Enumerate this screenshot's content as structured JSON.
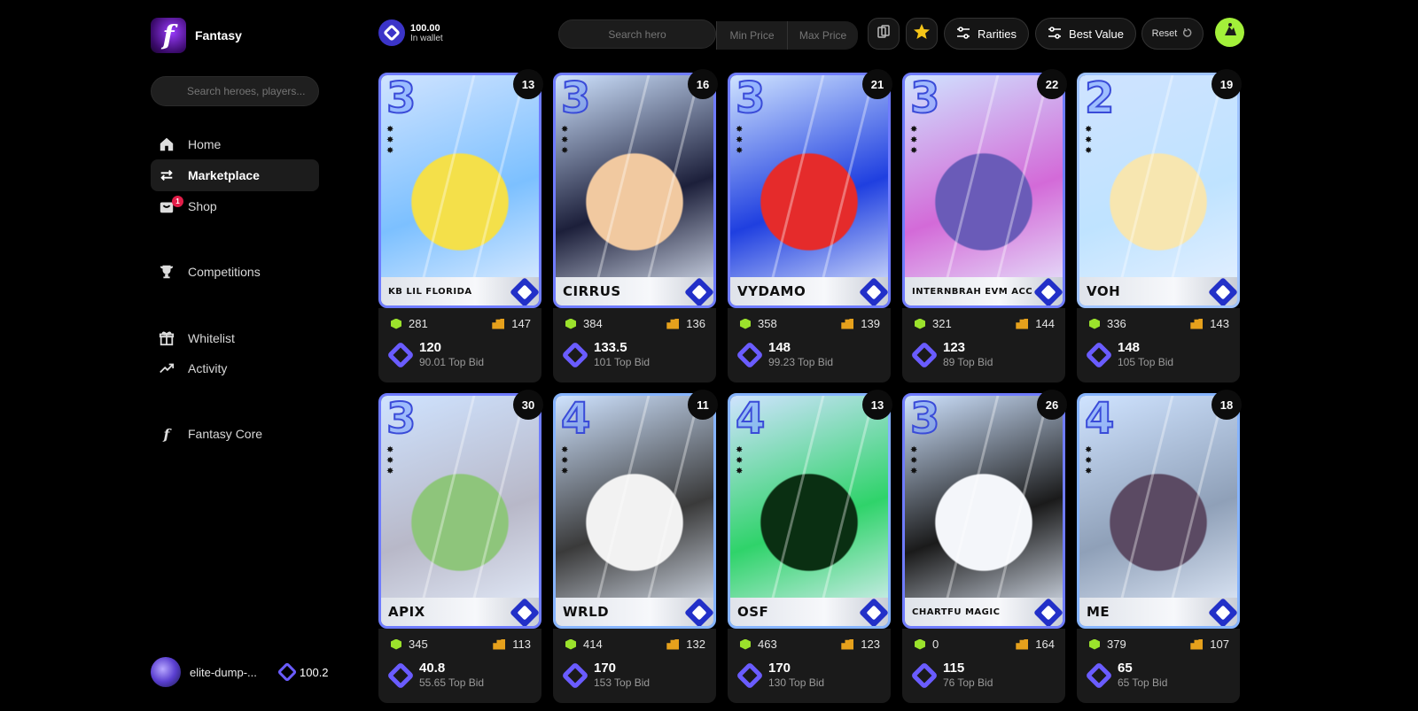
{
  "brand": {
    "name": "Fantasy",
    "logo_letter": "f"
  },
  "sidebar": {
    "search_placeholder": "Search heroes, players...",
    "items": [
      {
        "label": "Home",
        "icon": "home-icon"
      },
      {
        "label": "Marketplace",
        "icon": "swap-icon",
        "active": true
      },
      {
        "label": "Shop",
        "icon": "shop-icon",
        "badge": "1"
      },
      {
        "label": "Competitions",
        "icon": "trophy-icon"
      },
      {
        "label": "Whitelist",
        "icon": "gift-icon"
      },
      {
        "label": "Activity",
        "icon": "trending-up-icon"
      },
      {
        "label": "Fantasy Core",
        "icon": "fantasy-core-icon"
      }
    ]
  },
  "user": {
    "name": "elite-dump-...",
    "balance": "100.2"
  },
  "wallet": {
    "amount": "100.00",
    "label": "In wallet"
  },
  "filters": {
    "search_placeholder": "Search hero",
    "min_placeholder": "Min Price",
    "max_placeholder": "Max Price",
    "rarities_label": "Rarities",
    "sort_label": "Best Value",
    "reset_label": "Reset"
  },
  "colors": {
    "accent": "#6a5cff",
    "profile": "#a3f03a",
    "badge": "#e11d48",
    "stars_icon": "#9be22c",
    "building_icon": "#e6a11c"
  },
  "bid_word": "Top Bid",
  "cards": [
    {
      "name": "KB Lil Florida",
      "rank": "3",
      "level": "13",
      "stars": "281",
      "score": "147",
      "price": "120",
      "top_bid": "90.01"
    },
    {
      "name": "Cirrus",
      "rank": "3",
      "level": "16",
      "stars": "384",
      "score": "136",
      "price": "133.5",
      "top_bid": "101"
    },
    {
      "name": "Vydamo",
      "rank": "3",
      "level": "21",
      "stars": "358",
      "score": "139",
      "price": "148",
      "top_bid": "99.23"
    },
    {
      "name": "Internbrah EVM Acc",
      "rank": "3",
      "level": "22",
      "stars": "321",
      "score": "144",
      "price": "123",
      "top_bid": "89"
    },
    {
      "name": "Voh",
      "rank": "2",
      "level": "19",
      "stars": "336",
      "score": "143",
      "price": "148",
      "top_bid": "105"
    },
    {
      "name": "Apix",
      "rank": "3",
      "level": "30",
      "stars": "345",
      "score": "113",
      "price": "40.8",
      "top_bid": "55.65"
    },
    {
      "name": "Wrld",
      "rank": "4",
      "level": "11",
      "stars": "414",
      "score": "132",
      "price": "170",
      "top_bid": "153"
    },
    {
      "name": "OSF",
      "rank": "4",
      "level": "13",
      "stars": "463",
      "score": "123",
      "price": "170",
      "top_bid": "130"
    },
    {
      "name": "Chartfu Magic",
      "rank": "3",
      "level": "26",
      "stars": "0",
      "score": "164",
      "price": "115",
      "top_bid": "76"
    },
    {
      "name": "Me",
      "rank": "4",
      "level": "18",
      "stars": "379",
      "score": "107",
      "price": "65",
      "top_bid": "65"
    }
  ]
}
